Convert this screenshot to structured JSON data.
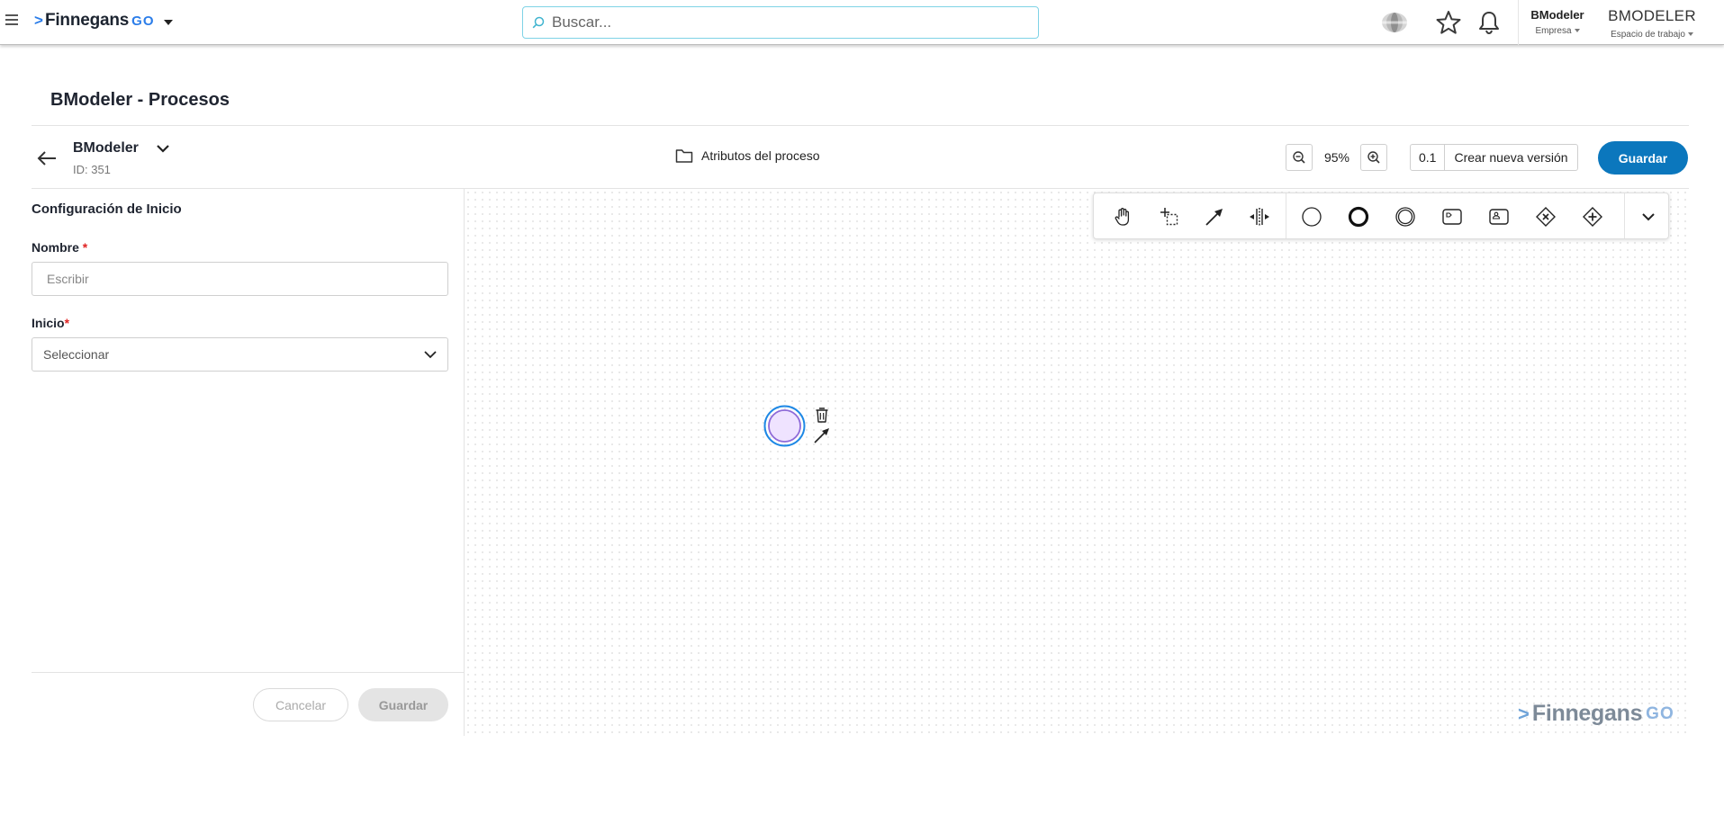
{
  "topbar": {
    "brand_chevron": ">",
    "brand_name": "Finnegans",
    "brand_go": "GO",
    "search_placeholder": "Buscar...",
    "empresa_value": "BModeler",
    "empresa_label": "Empresa",
    "espacio_value": "BMODELER",
    "espacio_label": "Espacio de trabajo",
    "icons": [
      "hamburger-icon",
      "sphere-icon",
      "star-icon",
      "bell-icon"
    ]
  },
  "page": {
    "title": "BModeler - Procesos"
  },
  "process": {
    "name": "BModeler",
    "id_label": "ID: 351",
    "attributes_label": "Atributos del proceso",
    "zoom": "95%",
    "version": "0.1",
    "new_version_label": "Crear nueva versión",
    "save_label": "Guardar"
  },
  "panel": {
    "title": "Configuración de Inicio",
    "nombre_label": "Nombre",
    "nombre_placeholder": "Escribir",
    "nombre_value": "",
    "inicio_label": "Inicio",
    "inicio_placeholder": "Seleccionar",
    "required_mark": "*",
    "cancel_label": "Cancelar",
    "save_label": "Guardar"
  },
  "palette": {
    "tools": [
      "hand-tool-icon",
      "lasso-tool-icon",
      "connect-tool-icon",
      "space-tool-icon",
      "start-event-icon",
      "end-event-icon",
      "intermediate-event-icon",
      "task-icon",
      "user-task-icon",
      "exclusive-gateway-icon",
      "parallel-gateway-icon",
      "expand-palette-icon"
    ]
  },
  "watermark": {
    "chevron": ">",
    "name": "Finnegans",
    "go": "GO"
  },
  "colors": {
    "accent": "#0b77bd",
    "brand_blue": "#2b7de9",
    "selection": "#1e88e5",
    "event_fill": "#efe3ff",
    "event_stroke": "#8e6ad8"
  }
}
